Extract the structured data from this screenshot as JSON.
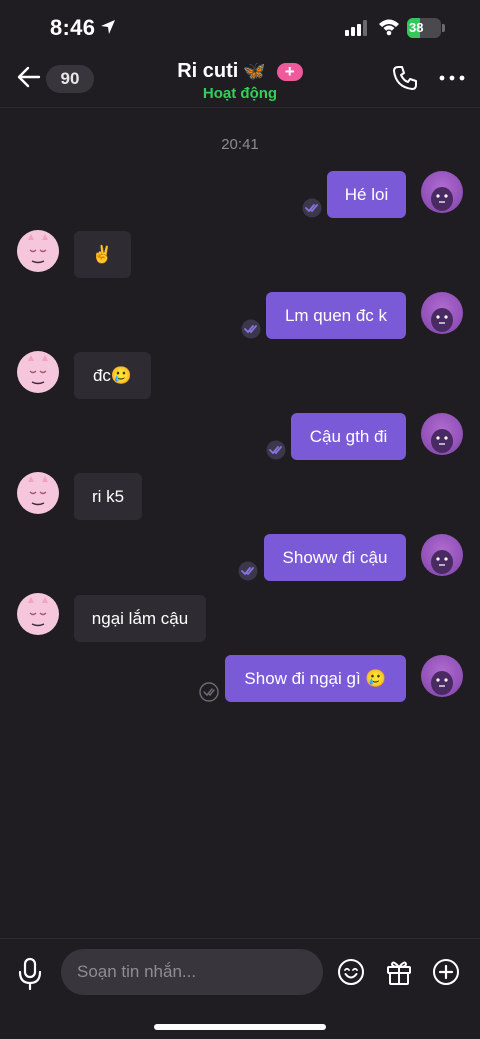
{
  "status_bar": {
    "time": "8:46",
    "battery_percent": "38",
    "battery_level": 0.38
  },
  "header": {
    "back_count": "90",
    "contact_name": "Ri cuti",
    "name_emoji": "🦋",
    "add_badge": "+",
    "contact_status": "Hoạt động"
  },
  "chat": {
    "time_divider": "20:41",
    "messages": [
      {
        "direction": "out",
        "text": "Hé loi",
        "status": "read"
      },
      {
        "direction": "in",
        "text": "✌️"
      },
      {
        "direction": "out",
        "text": "Lm quen đc k",
        "status": "read"
      },
      {
        "direction": "in",
        "text": "đc🥲"
      },
      {
        "direction": "out",
        "text": "Cậu gth đi",
        "status": "read"
      },
      {
        "direction": "in",
        "text": "ri k5"
      },
      {
        "direction": "out",
        "text": "Showw đi cậu",
        "status": "read"
      },
      {
        "direction": "in",
        "text": "ngại lắm cậu"
      },
      {
        "direction": "out",
        "text": "Show đi ngại gì 🥲",
        "status": "sent"
      }
    ]
  },
  "composer": {
    "placeholder": "Soạn tin nhắn..."
  },
  "colors": {
    "accent": "#7a5ad6",
    "online": "#30d158",
    "badge": "#ef5a9c",
    "background": "#1f1d22"
  }
}
